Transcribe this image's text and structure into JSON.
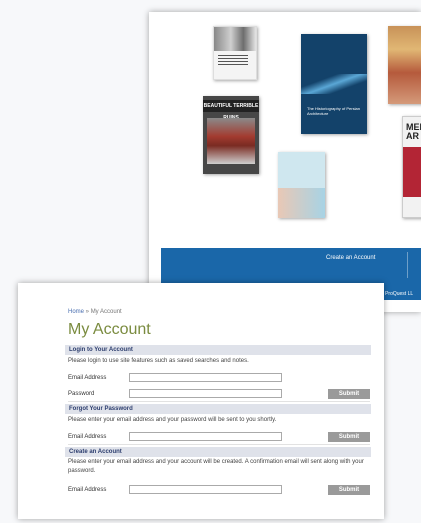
{
  "top_card": {
    "book_titles": {
      "book_beautiful": "BEAUTIFUL TERRIBLE RUINS",
      "book_persian": "The Historiography of Persian Architecture",
      "book_memory": "MEM AR"
    },
    "footer": {
      "create_account": "Create an Account",
      "copyright": "© ProQuest LL"
    }
  },
  "account_page": {
    "breadcrumb": {
      "home": "Home",
      "separator": " » ",
      "current": "My Account"
    },
    "title": "My Account",
    "login": {
      "header": "Login to Your Account",
      "description": "Please login to use site features such as saved searches and notes.",
      "email_label": "Email Address",
      "password_label": "Password",
      "submit": "Submit"
    },
    "forgot": {
      "header": "Forgot Your Password",
      "description": "Please enter your email address and your password will be sent to you shortly.",
      "email_label": "Email Address",
      "submit": "Submit"
    },
    "create": {
      "header": "Create an Account",
      "description": "Please enter your email address and your account will be created. A confirmation email will sent along with your password.",
      "email_label": "Email Address",
      "submit": "Submit"
    }
  },
  "colors": {
    "footer_blue": "#1a67a9",
    "title_green": "#7a8b3f",
    "section_bg": "#dfe2ea",
    "submit_gray": "#9a9a9a"
  }
}
